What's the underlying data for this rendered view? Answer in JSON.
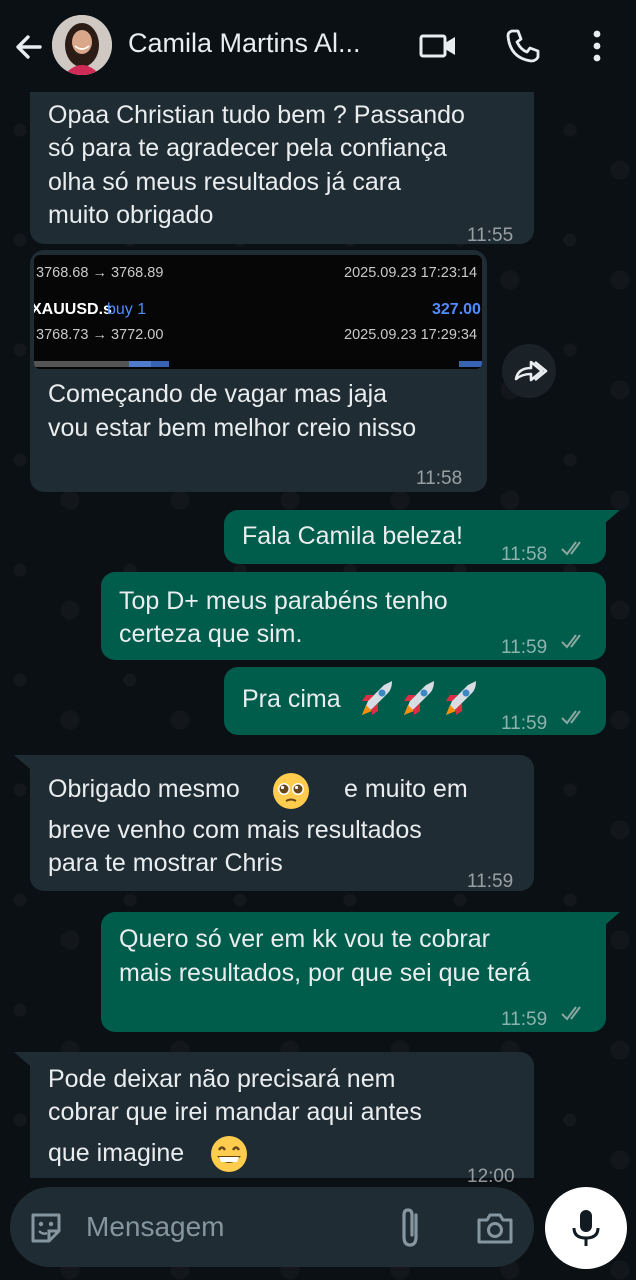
{
  "header": {
    "contact_name": "Camila Martins Al...",
    "icons": [
      "back-arrow-icon",
      "video-call-icon",
      "phone-icon",
      "more-options-icon"
    ]
  },
  "messages": [
    {
      "direction": "in",
      "lines": [
        "Opaa Christian tudo bem ? Passando",
        "só para te agradecer pela confiança",
        "olha só meus resultados já cara",
        "muito obrigado"
      ],
      "time": "11:55"
    },
    {
      "direction": "in",
      "type": "image-caption",
      "lines": [
        "Começando de vagar mas jaja",
        "vou estar bem melhor creio nisso"
      ],
      "time": "11:58"
    },
    {
      "direction": "out",
      "lines": [
        "Fala Camila beleza!"
      ],
      "time": "11:58"
    },
    {
      "direction": "out",
      "lines": [
        "Top D+ meus parabéns tenho",
        "certeza que sim."
      ],
      "time": "11:59"
    },
    {
      "direction": "out",
      "lines": [
        "Pra cima"
      ],
      "emoji": [
        "rocket",
        "rocket",
        "rocket"
      ],
      "time": "11:59"
    },
    {
      "direction": "in",
      "lines": [
        "Obrigado mesmo",
        "e muito em",
        "breve venho com mais resultados",
        "para te mostrar Chris"
      ],
      "emoji": [
        "pleading-face"
      ],
      "time": "11:59"
    },
    {
      "direction": "out",
      "lines": [
        "Quero só ver em kk vou te cobrar",
        "mais resultados, por que sei que terá"
      ],
      "time": "11:59"
    },
    {
      "direction": "in",
      "lines": [
        "Pode deixar não precisará nem",
        "cobrar que irei mandar aqui antes",
        "que imagine"
      ],
      "emoji": [
        "grinning-face"
      ],
      "time": "12:00"
    }
  ],
  "trade_screenshot": {
    "row1_prices": "3768.68 → 3768.89",
    "row1_date": "2025.09.23 17:23:14",
    "row2_symbol": "XAUUSD.s",
    "row2_side": "buy 1",
    "row2_profit": "327.00",
    "row3_prices": "3768.73 → 3772.00",
    "row3_date": "2025.09.23 17:29:34"
  },
  "input": {
    "placeholder": "Mensagem",
    "icons": [
      "sticker-icon",
      "attach-icon",
      "camera-icon",
      "mic-icon"
    ]
  },
  "colors": {
    "background": "#0b1014",
    "incoming": "#202c33",
    "outgoing": "#005c4b",
    "read_ticks": "#8aa8a0"
  }
}
